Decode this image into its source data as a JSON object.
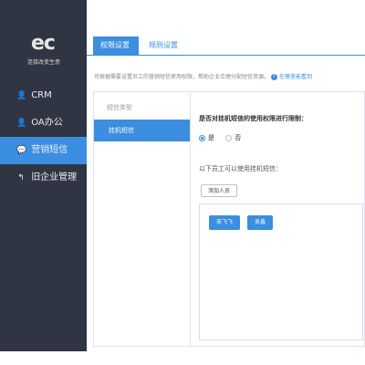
{
  "sidebar": {
    "logo": "ec",
    "subtitle": "连接改变生意",
    "items": [
      {
        "label": "CRM",
        "icon": "user-icon",
        "active": false
      },
      {
        "label": "OA办公",
        "icon": "user-icon",
        "active": false
      },
      {
        "label": "营销短信",
        "icon": "chat-icon",
        "active": true
      },
      {
        "label": "旧企业管理",
        "icon": "back-icon",
        "active": false
      }
    ]
  },
  "tabs": [
    {
      "label": "权限设置",
      "active": true
    },
    {
      "label": "规则设置",
      "active": false
    }
  ],
  "tip": {
    "text": "可根据需要设置员工的营销短信使用权限，帮助企业合理分配短信资源。",
    "help_text": "在哪里能看到"
  },
  "panel": {
    "left_title": "短信类型",
    "left_item": "挂机短信",
    "question": "是否对挂机短信的使用权限进行限制：",
    "radio_yes": "是",
    "radio_no": "否",
    "sub_text": "以下员工可以使用挂机短信：",
    "add_button": "添加人员",
    "people": [
      "吴飞飞",
      "吴鑫"
    ]
  },
  "colors": {
    "accent": "#3b8ee0",
    "sidebar_bg": "#2f3542"
  }
}
